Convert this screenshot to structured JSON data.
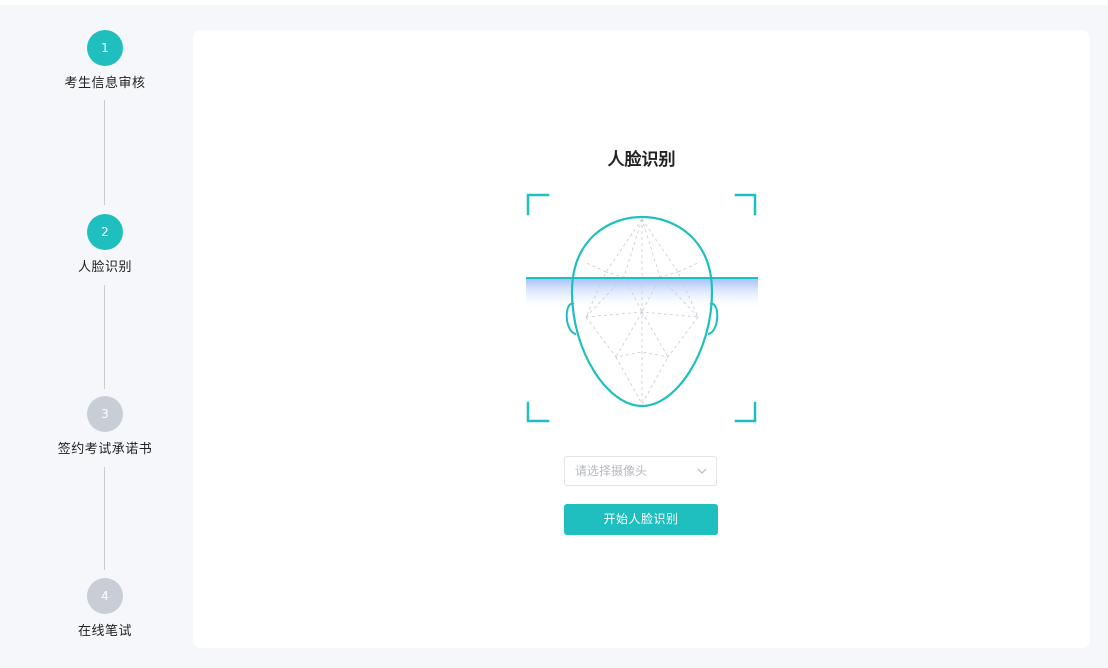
{
  "stepper": {
    "steps": [
      {
        "number": "1",
        "label": "考生信息审核",
        "state": "active"
      },
      {
        "number": "2",
        "label": "人脸识别",
        "state": "active"
      },
      {
        "number": "3",
        "label": "签约考试承诺书",
        "state": "inactive"
      },
      {
        "number": "4",
        "label": "在线笔试",
        "state": "inactive"
      }
    ]
  },
  "main": {
    "title": "人脸识别",
    "camera_select": {
      "placeholder": "请选择摄像头"
    },
    "start_button_label": "开始人脸识别"
  },
  "colors": {
    "accent": "#1fbfbf",
    "inactive_step": "#c9cdd6",
    "background": "#f6f7fa"
  },
  "icons": {
    "face_scan": "face-scan-icon",
    "dropdown": "chevron-down-icon"
  }
}
